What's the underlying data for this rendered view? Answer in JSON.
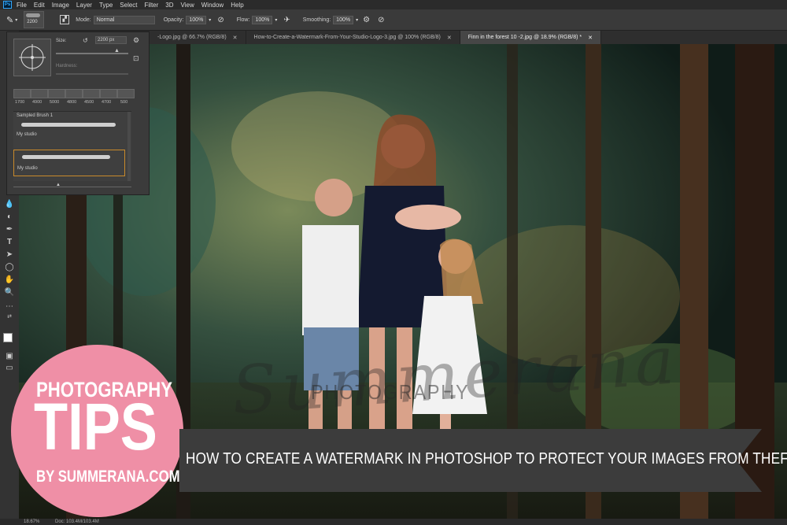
{
  "menubar": {
    "logo": "Ps",
    "items": [
      "File",
      "Edit",
      "Image",
      "Layer",
      "Type",
      "Select",
      "Filter",
      "3D",
      "View",
      "Window",
      "Help"
    ]
  },
  "options": {
    "brush_size": "2200",
    "mode_label": "Mode:",
    "mode_value": "Normal",
    "opacity_label": "Opacity:",
    "opacity_value": "100%",
    "flow_label": "Flow:",
    "flow_value": "100%",
    "smoothing_label": "Smoothing:",
    "smoothing_value": "100%"
  },
  "tabs": [
    {
      "label": "-Logo.jpg @ 66.7% (RGB/8)"
    },
    {
      "label": "How-to-Create-a-Watermark-From-Your-Studio-Logo-3.jpg @ 100% (RGB/8)"
    },
    {
      "label": "Finn in the forest 10 -2.jpg @ 18.9% (RGB/8) *"
    }
  ],
  "brush_panel": {
    "size_label": "Size:",
    "size_value": "2200 px",
    "hardness_label": "Hardness:",
    "preset_sizes": [
      "1700",
      "4900",
      "5000",
      "4800",
      "4500",
      "4700",
      "500"
    ],
    "brushes": [
      {
        "name": "Sampled Brush 1"
      },
      {
        "name": "My studio"
      },
      {
        "name": "My studio"
      }
    ]
  },
  "watermark": {
    "script": "Summerana",
    "caption": "PHOTOGRAPHY"
  },
  "badge": {
    "line1": "PHOTOGRAPHY",
    "line2": "TIPS",
    "line3": "BY SUMMERANA.COM",
    "color": "#ef8fa6"
  },
  "ribbon": {
    "text": "HOW TO CREATE A WATERMARK IN PHOTOSHOP TO PROTECT YOUR IMAGES FROM THEFT",
    "color": "#3c3c3c"
  },
  "status": {
    "zoom": "18.67%",
    "doc": "Doc: 103.4M/103.4M"
  }
}
